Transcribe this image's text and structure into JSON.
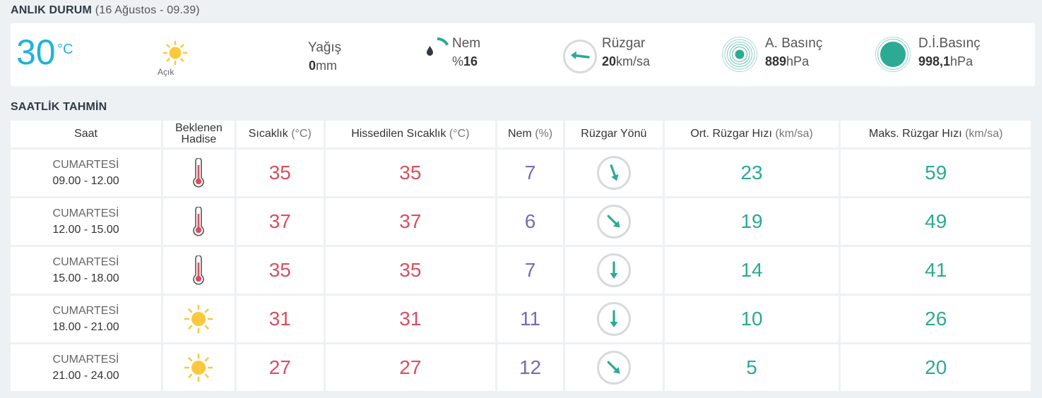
{
  "current": {
    "title": "ANLIK DURUM",
    "subtitle": "(16 Ağustos - 09.39)",
    "temperature": "30",
    "temp_unit": "°C",
    "condition": "Açık",
    "condition_icon": "sun-icon",
    "precip_label": "Yağış",
    "precip_value": "0",
    "precip_unit": "mm",
    "humidity_label": "Nem",
    "humidity_prefix": "%",
    "humidity_value": "16",
    "humidity_fraction": 0.16,
    "wind_label": "Rüzgar",
    "wind_value": "20",
    "wind_unit": "km/sa",
    "pressure_label": "A. Basınç",
    "pressure_value": "889",
    "pressure_unit": "hPa",
    "sea_pressure_label": "D.İ.Basınç",
    "sea_pressure_value": "998,1",
    "sea_pressure_unit": "hPa"
  },
  "hourly": {
    "title": "SAATLİK TAHMİN",
    "headers": {
      "saat": "Saat",
      "hadise": "Beklenen Hadise",
      "sicaklik": "Sıcaklık",
      "sicaklik_unit": "(°C)",
      "hissedilen": "Hissedilen Sıcaklık",
      "hissedilen_unit": "(°C)",
      "nem": "Nem",
      "nem_unit": "(%)",
      "yon": "Rüzgar Yönü",
      "ort": "Ort. Rüzgar Hızı",
      "ort_unit": "(km/sa)",
      "maks": "Maks. Rüzgar Hızı",
      "maks_unit": "(km/sa)"
    },
    "rows": [
      {
        "day": "CUMARTESİ",
        "hours": "09.00 - 12.00",
        "hadise": "thermometer-icon",
        "temp": "35",
        "feels": "35",
        "humidity": "7",
        "wind_dir_deg": 160,
        "wind_avg": "23",
        "wind_max": "59"
      },
      {
        "day": "CUMARTESİ",
        "hours": "12.00 - 15.00",
        "hadise": "thermometer-icon",
        "temp": "37",
        "feels": "37",
        "humidity": "6",
        "wind_dir_deg": 135,
        "wind_avg": "19",
        "wind_max": "49"
      },
      {
        "day": "CUMARTESİ",
        "hours": "15.00 - 18.00",
        "hadise": "thermometer-icon",
        "temp": "35",
        "feels": "35",
        "humidity": "7",
        "wind_dir_deg": 180,
        "wind_avg": "14",
        "wind_max": "41"
      },
      {
        "day": "CUMARTESİ",
        "hours": "18.00 - 21.00",
        "hadise": "sun-icon",
        "temp": "31",
        "feels": "31",
        "humidity": "11",
        "wind_dir_deg": 180,
        "wind_avg": "10",
        "wind_max": "26"
      },
      {
        "day": "CUMARTESİ",
        "hours": "21.00 - 24.00",
        "hadise": "sun-icon",
        "temp": "27",
        "feels": "27",
        "humidity": "12",
        "wind_dir_deg": 135,
        "wind_avg": "5",
        "wind_max": "20"
      }
    ]
  },
  "colors": {
    "accent_blue": "#1fb3d9",
    "temp_red": "#d8505f",
    "humidity_purple": "#7a69b5",
    "wind_green": "#2baa94",
    "sun_yellow": "#fbc93d"
  }
}
